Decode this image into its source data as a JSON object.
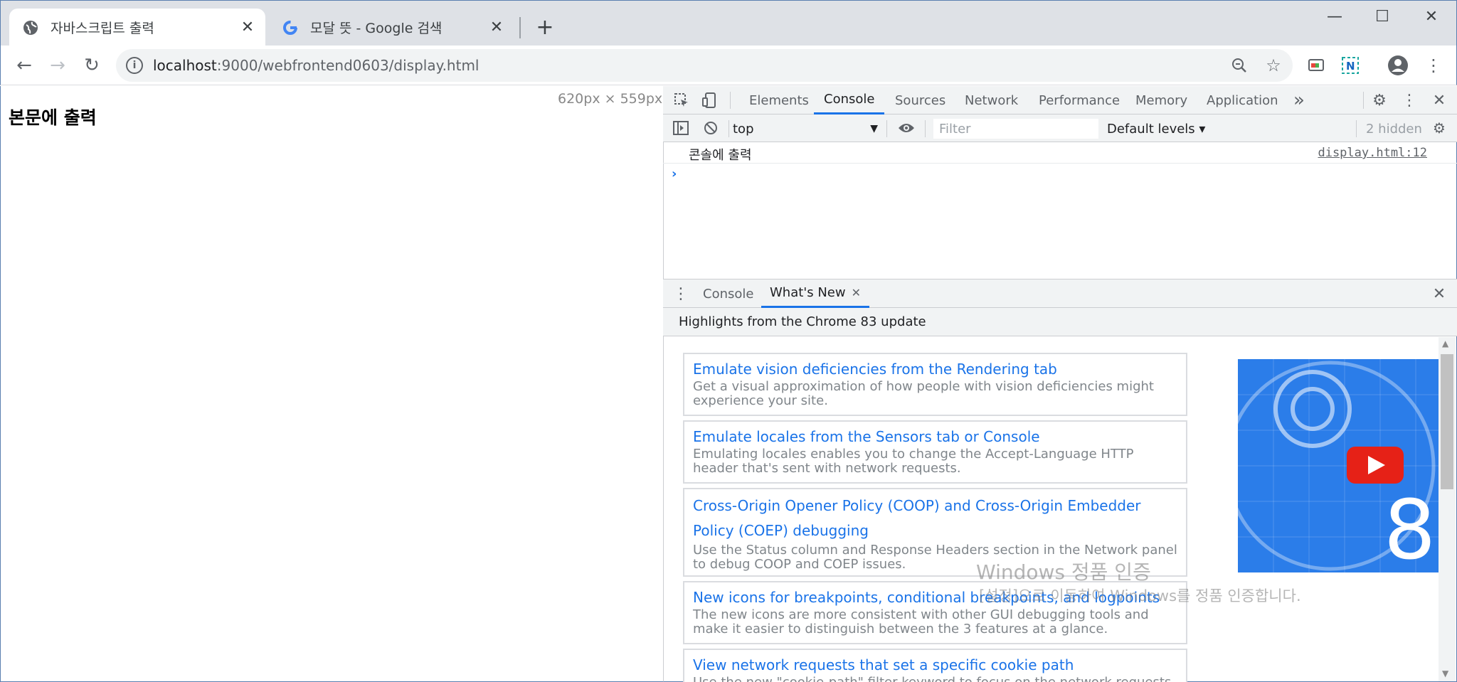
{
  "browser": {
    "tabs": [
      {
        "title": "자바스크립트 출력",
        "icon": "globe-icon",
        "active": true
      },
      {
        "title": "모달 뜻 - Google 검색",
        "icon": "google-icon",
        "active": false
      }
    ],
    "new_tab_symbol": "+",
    "close_symbol": "✕",
    "window_controls": {
      "minimize": "—",
      "maximize": "☐",
      "close": "✕"
    },
    "nav": {
      "back": "←",
      "forward": "→",
      "reload": "↻"
    },
    "url": {
      "host": "localhost",
      "rest": ":9000/webfrontend0603/display.html"
    },
    "toolbar_icons": [
      "zoom-icon",
      "bookmark-star-icon",
      "cast-icon",
      "extension-icon",
      "profile-icon",
      "menu-icon"
    ]
  },
  "page": {
    "heading": "본문에 출력",
    "viewport_size": "620px × 559px"
  },
  "devtools": {
    "tabs": [
      "Elements",
      "Console",
      "Sources",
      "Network",
      "Performance",
      "Memory",
      "Application"
    ],
    "selected_tab": "Console",
    "more_tabs": "»",
    "console_toolbar": {
      "context": "top",
      "filter_placeholder": "Filter",
      "levels": "Default levels ▾",
      "hidden": "2 hidden"
    },
    "messages": [
      {
        "text": "콘솔에 출력",
        "source": "display.html:12"
      }
    ],
    "prompt": "›",
    "drawer": {
      "tabs": [
        "Console",
        "What's New"
      ],
      "selected_tab": "What's New",
      "header": "Highlights from the Chrome 83 update",
      "cards": [
        {
          "title": "Emulate vision deficiencies from the Rendering tab",
          "desc": "Get a visual approximation of how people with vision deficiencies might experience your site."
        },
        {
          "title": "Emulate locales from the Sensors tab or Console",
          "desc": "Emulating locales enables you to change the Accept-Language HTTP header that's sent with network requests."
        },
        {
          "title": "Cross-Origin Opener Policy (COOP) and Cross-Origin Embedder Policy (COEP) debugging",
          "desc": "Use the Status column and Response Headers section in the Network panel to debug COOP and COEP issues."
        },
        {
          "title": "New icons for breakpoints, conditional breakpoints, and logpoints",
          "desc": "The new icons are more consistent with other GUI debugging tools and make it easier to distinguish between the 3 features at a glance."
        },
        {
          "title": "View network requests that set a specific cookie path",
          "desc": "Use the new \"cookie-path\" filter keyword to focus on the network requests that"
        }
      ],
      "video_label": "8"
    }
  },
  "os_watermark": {
    "line1": "Windows 정품 인증",
    "line2": "[설정]으로 이동하여 Windows를 정품 인증합니다."
  },
  "colors": {
    "accent": "#1a73e8",
    "tabstrip": "#dee1e6",
    "video_bg": "#2b7de9"
  }
}
